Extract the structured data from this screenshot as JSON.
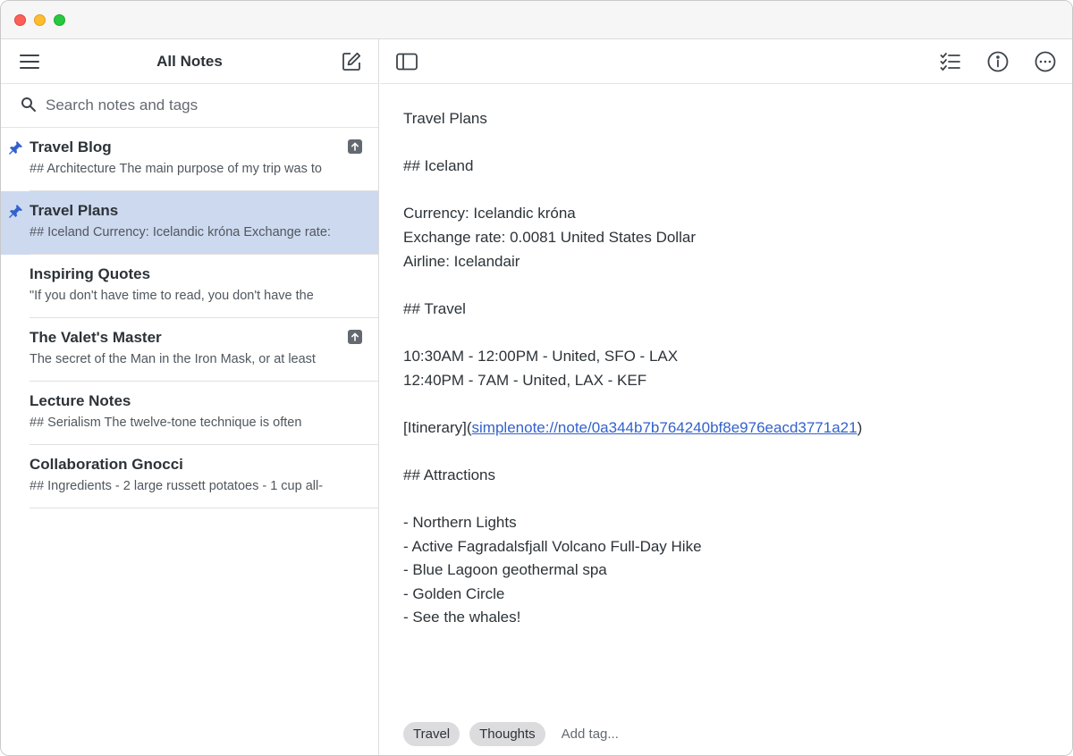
{
  "window": {
    "controls": [
      "close",
      "minimize",
      "maximize"
    ]
  },
  "sidebar": {
    "title": "All Notes",
    "menu_icon": "hamburger-menu-icon",
    "new_note_icon": "new-note-icon",
    "search": {
      "placeholder": "Search notes and tags",
      "value": ""
    },
    "notes": [
      {
        "title": "Travel Blog",
        "excerpt": "## Architecture The main purpose of my trip was to",
        "pinned": true,
        "published": true,
        "selected": false
      },
      {
        "title": "Travel Plans",
        "excerpt": "## Iceland Currency: Icelandic króna Exchange rate:",
        "pinned": true,
        "published": false,
        "selected": true
      },
      {
        "title": "Inspiring Quotes",
        "excerpt": "\"If you don't have time to read, you don't have the",
        "pinned": false,
        "published": false,
        "selected": false
      },
      {
        "title": "The Valet's Master",
        "excerpt": "The secret of the Man in the Iron Mask, or at least",
        "pinned": false,
        "published": true,
        "selected": false
      },
      {
        "title": "Lecture Notes",
        "excerpt": "## Serialism The twelve-tone technique is often",
        "pinned": false,
        "published": false,
        "selected": false
      },
      {
        "title": "Collaboration Gnocci",
        "excerpt": "## Ingredients - 2 large russett potatoes - 1 cup all-",
        "pinned": false,
        "published": false,
        "selected": false
      }
    ]
  },
  "editor": {
    "toolbar": {
      "sidebar_toggle_icon": "sidebar-toggle-icon",
      "checklist_icon": "checklist-icon",
      "info_icon": "info-icon",
      "more_icon": "more-options-icon"
    },
    "lines": [
      "Travel Plans",
      "",
      "## Iceland",
      "",
      "Currency: Icelandic króna",
      "Exchange rate: 0.0081 United States Dollar",
      "Airline: Icelandair",
      "",
      "## Travel",
      "",
      "10:30AM - 12:00PM - United, SFO - LAX",
      "12:40PM - 7AM - United, LAX - KEF",
      "",
      "__LINK__",
      "",
      "## Attractions",
      "",
      "- Northern Lights",
      "- Active Fagradalsfjall Volcano Full-Day Hike",
      "- Blue Lagoon geothermal spa",
      "- Golden Circle",
      "- See the whales!"
    ],
    "link_line": {
      "prefix": "[Itinerary](",
      "url": "simplenote://note/0a344b7b764240bf8e976eacd3771a21",
      "suffix": ")"
    },
    "tags": [
      "Travel",
      "Thoughts"
    ],
    "add_tag_placeholder": "Add tag..."
  },
  "colors": {
    "selected_row": "#ccd9ef",
    "pin": "#3361cc",
    "link": "#3361cc",
    "tag_bg": "#dcdcde"
  }
}
